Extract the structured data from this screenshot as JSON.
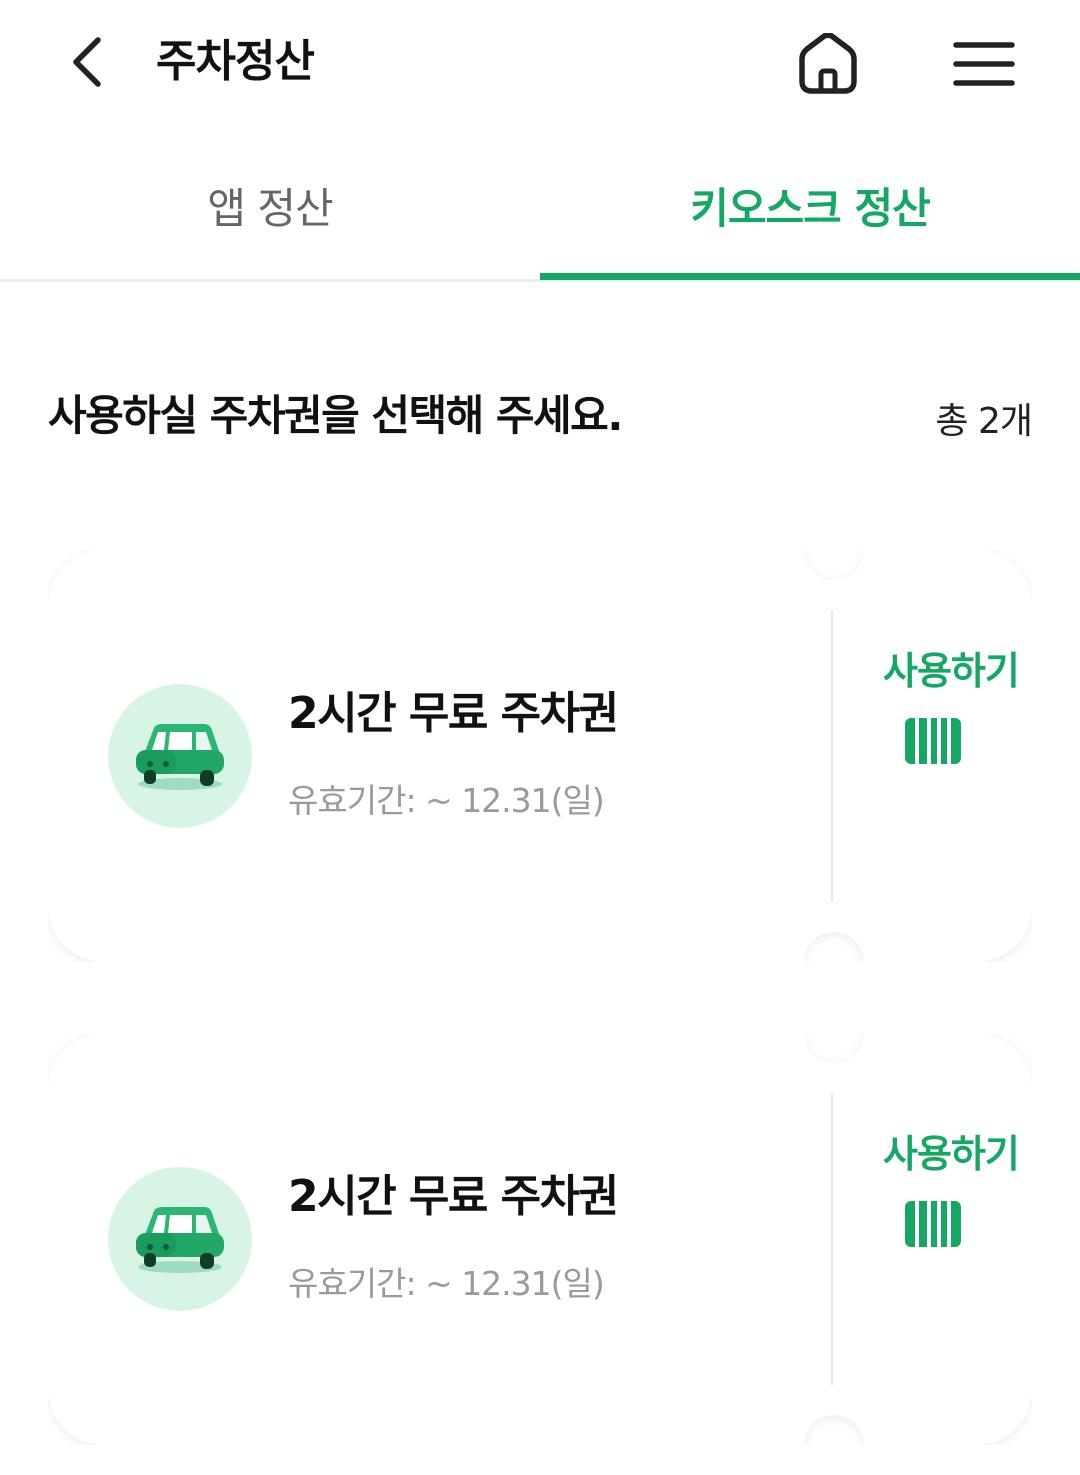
{
  "header": {
    "title": "주차정산",
    "back_icon": "chevron-left-icon",
    "home_icon": "home-icon",
    "menu_icon": "hamburger-menu-icon"
  },
  "tabs": [
    {
      "label": "앱 정산",
      "selected": false
    },
    {
      "label": "키오스크 정산",
      "selected": true
    }
  ],
  "colors": {
    "accent": "#15a864",
    "car_bg": "#d7f4e5",
    "muted_text": "#9a9a9a"
  },
  "section": {
    "title": "사용하실 주차권을 선택해 주세요.",
    "total": "총 2개"
  },
  "tickets": [
    {
      "name": "2시간 무료 주차권",
      "validity": "유효기간: ~ 12.31(일)",
      "use_label": "사용하기",
      "icon": "car-icon",
      "action_icon": "barcode-icon"
    },
    {
      "name": "2시간 무료 주차권",
      "validity": "유효기간: ~ 12.31(일)",
      "use_label": "사용하기",
      "icon": "car-icon",
      "action_icon": "barcode-icon"
    }
  ]
}
